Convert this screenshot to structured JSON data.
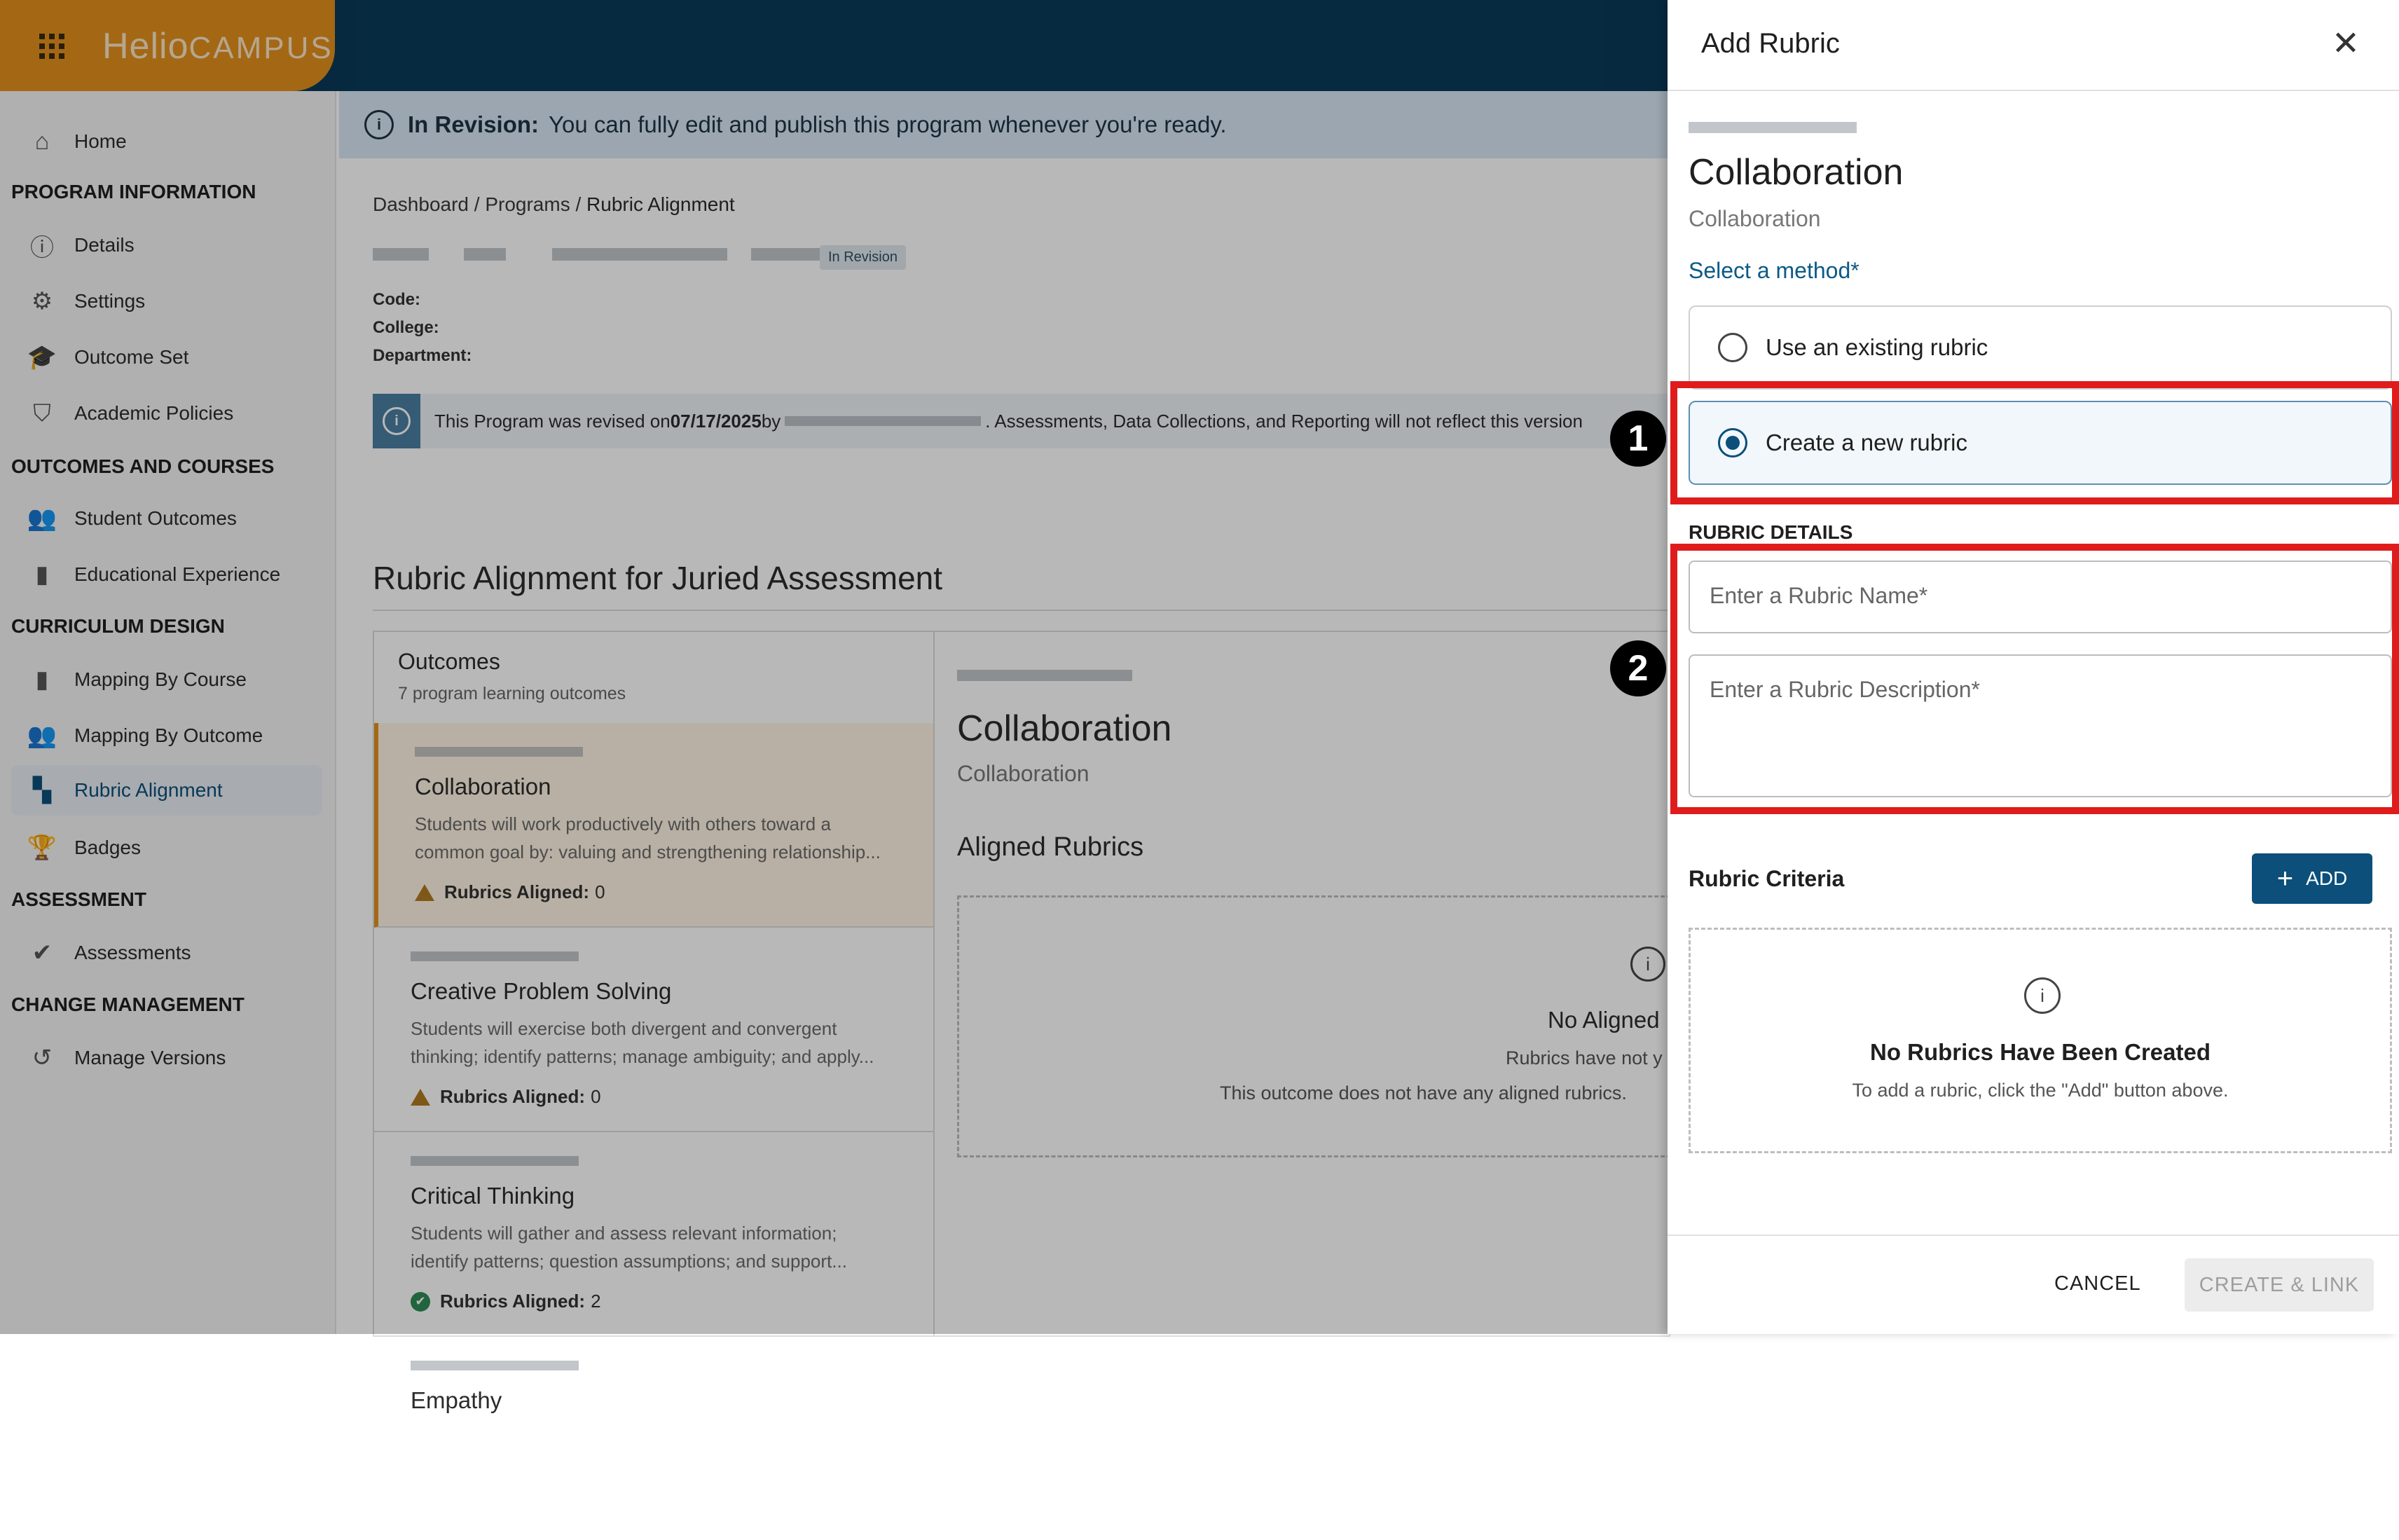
{
  "brand": {
    "prefix": "Helio",
    "suffix": "CAMPUS"
  },
  "sidebar": {
    "home": "Home",
    "sections": [
      {
        "title": "PROGRAM INFORMATION",
        "items": [
          "Details",
          "Settings",
          "Outcome Set",
          "Academic Policies"
        ]
      },
      {
        "title": "OUTCOMES AND COURSES",
        "items": [
          "Student Outcomes",
          "Educational Experience"
        ]
      },
      {
        "title": "CURRICULUM DESIGN",
        "items": [
          "Mapping By Course",
          "Mapping By Outcome",
          "Rubric Alignment",
          "Badges"
        ]
      },
      {
        "title": "ASSESSMENT",
        "items": [
          "Assessments"
        ]
      },
      {
        "title": "CHANGE MANAGEMENT",
        "items": [
          "Manage Versions"
        ]
      }
    ],
    "active": "Rubric Alignment"
  },
  "banner": {
    "label": "In Revision:",
    "text": "You can fully edit and publish this program whenever you're ready."
  },
  "breadcrumb": {
    "items": [
      "Dashboard /",
      "Programs /"
    ],
    "current": "Rubric Alignment"
  },
  "program": {
    "badge": "In Revision",
    "code_label": "Code:",
    "college_label": "College:",
    "department_label": "Department:"
  },
  "notice": {
    "prefix": "This Program was revised on ",
    "date": "07/17/2025",
    "by": " by",
    "suffix": ". Assessments, Data Collections, and Reporting will not reflect this version"
  },
  "page": {
    "title": "Rubric Alignment for Juried Assessment"
  },
  "outcomes_panel": {
    "title": "Outcomes",
    "subtitle": "7 program learning outcomes",
    "aligned_label": "Rubrics Aligned:",
    "items": [
      {
        "name": "Collaboration",
        "desc1": "Students will work productively with others toward a",
        "desc2": "common goal by: valuing and strengthening relationship...",
        "aligned": "0",
        "status": "warning"
      },
      {
        "name": "Creative Problem Solving",
        "desc1": "Students will exercise both divergent and convergent",
        "desc2": "thinking; identify patterns; manage ambiguity; and apply...",
        "aligned": "0",
        "status": "warning"
      },
      {
        "name": "Critical Thinking",
        "desc1": "Students will gather and assess relevant information;",
        "desc2": "identify patterns; question assumptions; and support...",
        "aligned": "2",
        "status": "ok"
      },
      {
        "name": "Empathy",
        "desc1": "",
        "desc2": "",
        "aligned": "",
        "status": ""
      }
    ]
  },
  "detail_panel": {
    "name": "Collaboration",
    "subtitle": "Collaboration",
    "aligned_heading": "Aligned Rubrics",
    "empty_title": "No Aligned",
    "empty_line1": "Rubrics have not y",
    "empty_line2": "This outcome does not have any aligned rubrics."
  },
  "drawer": {
    "title": "Add Rubric",
    "outcome_name": "Collaboration",
    "outcome_sub": "Collaboration",
    "method_label": "Select a method",
    "required_mark": "*",
    "option_existing": "Use an existing rubric",
    "option_new": "Create a new rubric",
    "selected": "new",
    "details_heading": "RUBRIC DETAILS",
    "name_placeholder": "Enter a Rubric Name",
    "desc_placeholder": "Enter a Rubric Description",
    "criteria_label": "Rubric Criteria",
    "add_label": "ADD",
    "empty_title": "No Rubrics Have Been Created",
    "empty_text": "To add a rubric, click the \"Add\" button above.",
    "cancel_label": "CANCEL",
    "create_label": "CREATE & LINK"
  },
  "annotations": {
    "marker1": "1",
    "marker2": "2",
    "color": "#e01b1b"
  },
  "colors": {
    "brand_orange": "#e3911d",
    "navy": "#093a59",
    "primary": "#0b4f7a"
  }
}
